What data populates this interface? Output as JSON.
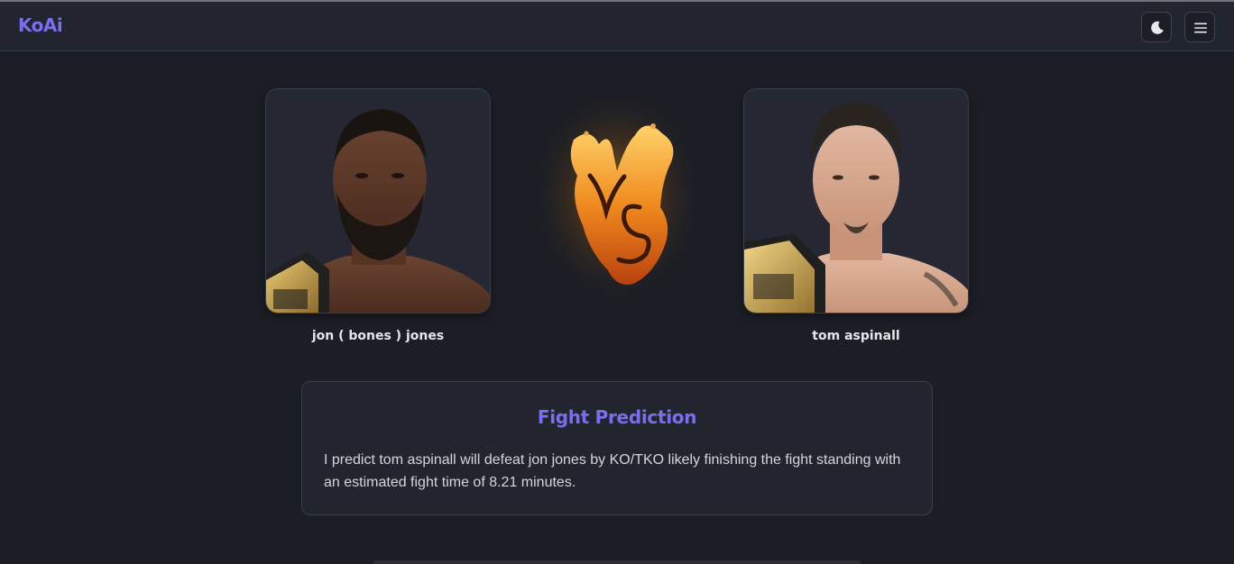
{
  "navbar": {
    "brand": "KoAi",
    "theme_toggle_icon": "moon-icon",
    "menu_icon": "hamburger-menu-icon"
  },
  "matchup": {
    "fighter_left": {
      "name": "jon ( bones ) jones",
      "image": "fighter-photo"
    },
    "vs_graphic": "flaming-vs-icon",
    "fighter_right": {
      "name": "tom aspinall",
      "image": "fighter-photo"
    }
  },
  "prediction": {
    "title": "Fight Prediction",
    "text": "I predict tom aspinall will defeat jon jones by KO/TKO likely finishing the fight standing with an estimated fight time of 8.21 minutes."
  },
  "colors": {
    "accent": "#7c6cf0",
    "background": "#1b1e25",
    "navbar": "#22252e",
    "card": "#252832"
  }
}
